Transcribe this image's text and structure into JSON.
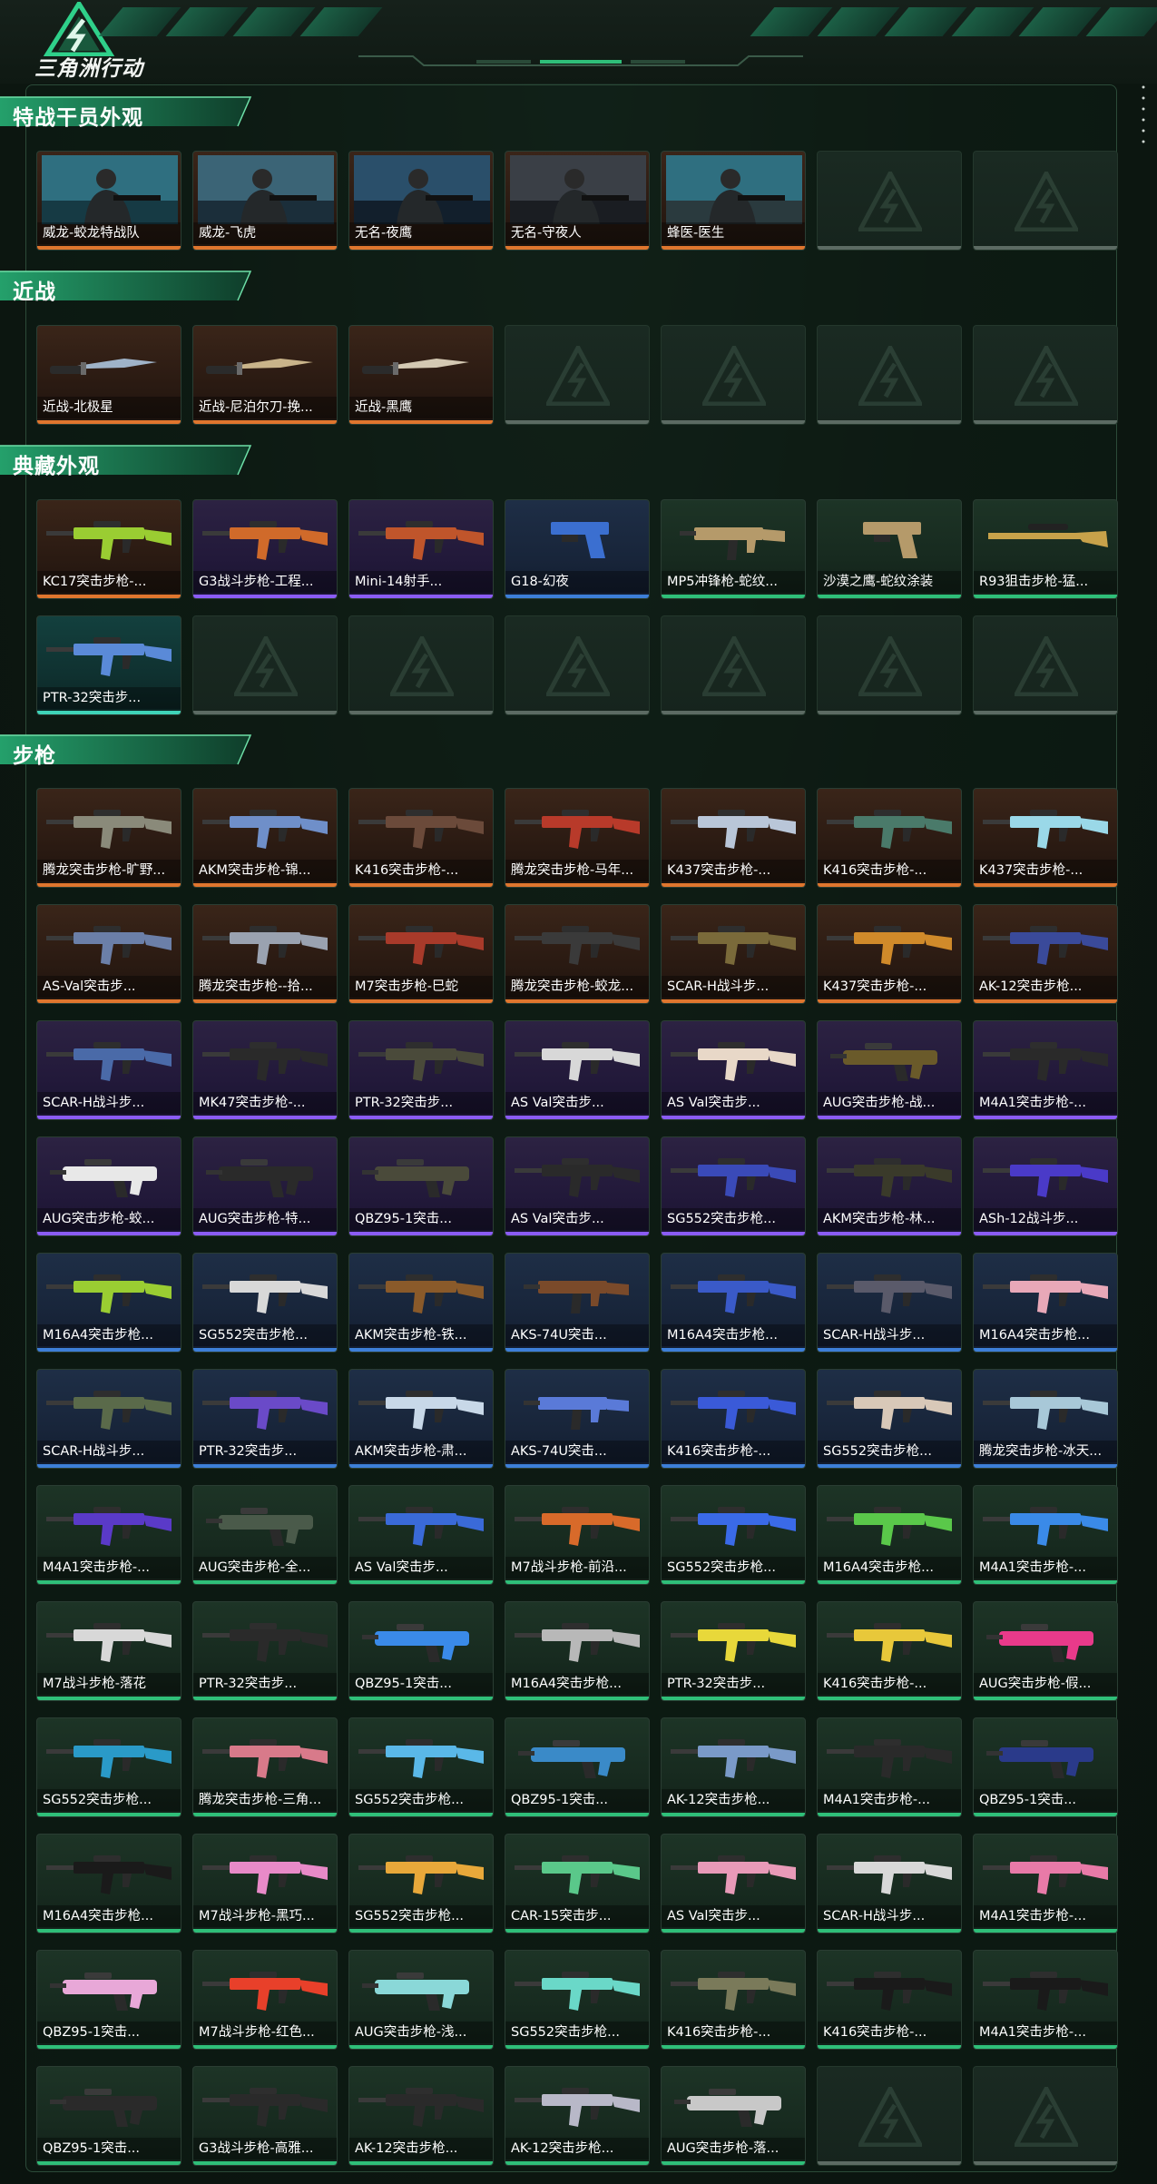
{
  "app": {
    "title": "三角洲行动",
    "logo_icon": "delta-force-emblem-icon"
  },
  "colors": {
    "accent": "#2fbf79",
    "rarity_orange": "#e0762e",
    "rarity_purple": "#8b5cf6",
    "rarity_blue": "#3d7fd8",
    "rarity_green": "#2fbf79",
    "rarity_teal": "#3fd4b8"
  },
  "sections": [
    {
      "key": "operators",
      "title": "特战干员外观",
      "items": [
        {
          "label": "威龙-蛟龙特战队",
          "rarity": "orange",
          "kind": "operator"
        },
        {
          "label": "威龙-飞虎",
          "rarity": "orange",
          "kind": "operator"
        },
        {
          "label": "无名-夜鹰",
          "rarity": "orange",
          "kind": "operator"
        },
        {
          "label": "无名-守夜人",
          "rarity": "orange",
          "kind": "operator"
        },
        {
          "label": "蜂医-医生",
          "rarity": "orange",
          "kind": "operator"
        },
        {
          "label": "",
          "rarity": "empty"
        },
        {
          "label": "",
          "rarity": "empty"
        }
      ]
    },
    {
      "key": "melee",
      "title": "近战",
      "items": [
        {
          "label": "近战-北极星",
          "rarity": "orange",
          "kind": "knife",
          "color": "#9fb3c8"
        },
        {
          "label": "近战-尼泊尔刀-挽...",
          "rarity": "orange",
          "kind": "knife",
          "color": "#c9b48a"
        },
        {
          "label": "近战-黑鹰",
          "rarity": "orange",
          "kind": "knife",
          "color": "#d4c9b3"
        },
        {
          "label": "",
          "rarity": "empty"
        },
        {
          "label": "",
          "rarity": "empty"
        },
        {
          "label": "",
          "rarity": "empty"
        },
        {
          "label": "",
          "rarity": "empty"
        }
      ]
    },
    {
      "key": "collection",
      "title": "典藏外观",
      "items": [
        {
          "label": "KC17突击步枪-...",
          "rarity": "orange",
          "kind": "rifle",
          "color": "#9acd32"
        },
        {
          "label": "G3战斗步枪-工程...",
          "rarity": "purple",
          "kind": "rifle",
          "color": "#d06a2a"
        },
        {
          "label": "Mini-14射手...",
          "rarity": "purple",
          "kind": "rifle",
          "color": "#c0552b"
        },
        {
          "label": "G18-幻夜",
          "rarity": "blue",
          "kind": "pistol",
          "color": "#3b6fd0"
        },
        {
          "label": "MP5冲锋枪-蛇纹...",
          "rarity": "green",
          "kind": "smg",
          "color": "#b59a6a"
        },
        {
          "label": "沙漠之鹰-蛇纹涂装",
          "rarity": "green",
          "kind": "pistol",
          "color": "#b59a6a"
        },
        {
          "label": "R93狙击步枪-猛...",
          "rarity": "green",
          "kind": "sniper",
          "color": "#c8a24a"
        },
        {
          "label": "PTR-32突击步...",
          "rarity": "teal",
          "kind": "rifle",
          "color": "#5a8ad8"
        },
        {
          "label": "",
          "rarity": "empty"
        },
        {
          "label": "",
          "rarity": "empty"
        },
        {
          "label": "",
          "rarity": "empty"
        },
        {
          "label": "",
          "rarity": "empty"
        },
        {
          "label": "",
          "rarity": "empty"
        },
        {
          "label": "",
          "rarity": "empty"
        }
      ]
    },
    {
      "key": "rifles",
      "title": "步枪",
      "items": [
        {
          "label": "腾龙突击步枪-旷野...",
          "rarity": "orange",
          "kind": "rifle",
          "color": "#8a8a7a"
        },
        {
          "label": "AKM突击步枪-锦...",
          "rarity": "orange",
          "kind": "rifle",
          "color": "#6f8fc9"
        },
        {
          "label": "K416突击步枪-...",
          "rarity": "orange",
          "kind": "rifle",
          "color": "#6b4a3a"
        },
        {
          "label": "腾龙突击步枪-马年...",
          "rarity": "orange",
          "kind": "rifle",
          "color": "#b83a2a"
        },
        {
          "label": "K437突击步枪-...",
          "rarity": "orange",
          "kind": "rifle",
          "color": "#b9c6d8"
        },
        {
          "label": "K416突击步枪-...",
          "rarity": "orange",
          "kind": "rifle",
          "color": "#4a7a6a"
        },
        {
          "label": "K437突击步枪-...",
          "rarity": "orange",
          "kind": "rifle",
          "color": "#9ad8e8"
        },
        {
          "label": "AS-Val突击步...",
          "rarity": "orange",
          "kind": "rifle",
          "color": "#6b7fa8"
        },
        {
          "label": "腾龙突击步枪--拾...",
          "rarity": "orange",
          "kind": "rifle",
          "color": "#9aa2b0"
        },
        {
          "label": "M7突击步枪-巳蛇",
          "rarity": "orange",
          "kind": "rifle",
          "color": "#a83a2a"
        },
        {
          "label": "腾龙突击步枪-蛟龙...",
          "rarity": "orange",
          "kind": "rifle",
          "color": "#3a3a3a"
        },
        {
          "label": "SCAR-H战斗步...",
          "rarity": "orange",
          "kind": "rifle",
          "color": "#7a6a3a"
        },
        {
          "label": "K437突击步枪-...",
          "rarity": "orange",
          "kind": "rifle",
          "color": "#d08a2a"
        },
        {
          "label": "AK-12突击步枪...",
          "rarity": "orange",
          "kind": "rifle",
          "color": "#3a4a9a"
        },
        {
          "label": "SCAR-H战斗步...",
          "rarity": "purple",
          "kind": "rifle",
          "color": "#4a6aa8"
        },
        {
          "label": "MK47突击步枪-...",
          "rarity": "purple",
          "kind": "rifle",
          "color": "#2a2a2a"
        },
        {
          "label": "PTR-32突击步...",
          "rarity": "purple",
          "kind": "rifle",
          "color": "#4a4a3a"
        },
        {
          "label": "AS Val突击步...",
          "rarity": "purple",
          "kind": "rifle",
          "color": "#d8d8d8"
        },
        {
          "label": "AS Val突击步...",
          "rarity": "purple",
          "kind": "rifle",
          "color": "#e8d8c8"
        },
        {
          "label": "AUG突击步枪-战...",
          "rarity": "purple",
          "kind": "bullpup",
          "color": "#6a5a2a"
        },
        {
          "label": "M4A1突击步枪-...",
          "rarity": "purple",
          "kind": "rifle",
          "color": "#2a2a2a"
        },
        {
          "label": "AUG突击步枪-蛟...",
          "rarity": "purple",
          "kind": "bullpup",
          "color": "#e8e8e8"
        },
        {
          "label": "AUG突击步枪-特...",
          "rarity": "purple",
          "kind": "bullpup",
          "color": "#2a2a2a"
        },
        {
          "label": "QBZ95-1突击...",
          "rarity": "purple",
          "kind": "bullpup",
          "color": "#4a4a3a"
        },
        {
          "label": "AS Val突击步...",
          "rarity": "purple",
          "kind": "rifle",
          "color": "#2a2a2a"
        },
        {
          "label": "SG552突击步枪...",
          "rarity": "purple",
          "kind": "rifle",
          "color": "#3a4ab8"
        },
        {
          "label": "AKM突击步枪-林...",
          "rarity": "purple",
          "kind": "rifle",
          "color": "#3a3a2a"
        },
        {
          "label": "ASh-12战斗步...",
          "rarity": "purple",
          "kind": "rifle",
          "color": "#4a3ac8"
        },
        {
          "label": "M16A4突击步枪...",
          "rarity": "blue",
          "kind": "rifle",
          "color": "#9acd32"
        },
        {
          "label": "SG552突击步枪...",
          "rarity": "blue",
          "kind": "rifle",
          "color": "#d8d8d8"
        },
        {
          "label": "AKM突击步枪-铁...",
          "rarity": "blue",
          "kind": "rifle",
          "color": "#8a5a2a"
        },
        {
          "label": "AKS-74U突击...",
          "rarity": "blue",
          "kind": "smg",
          "color": "#7a4a2a"
        },
        {
          "label": "M16A4突击步枪...",
          "rarity": "blue",
          "kind": "rifle",
          "color": "#3a5ac8"
        },
        {
          "label": "SCAR-H战斗步...",
          "rarity": "blue",
          "kind": "rifle",
          "color": "#5a5a6a"
        },
        {
          "label": "M16A4突击步枪...",
          "rarity": "blue",
          "kind": "rifle",
          "color": "#e8a8b8"
        },
        {
          "label": "SCAR-H战斗步...",
          "rarity": "blue",
          "kind": "rifle",
          "color": "#5a6a4a"
        },
        {
          "label": "PTR-32突击步...",
          "rarity": "blue",
          "kind": "rifle",
          "color": "#6a4ac8"
        },
        {
          "label": "AKM突击步枪-肃...",
          "rarity": "blue",
          "kind": "rifle",
          "color": "#c8d8e8"
        },
        {
          "label": "AKS-74U突击...",
          "rarity": "blue",
          "kind": "smg",
          "color": "#5a7ad8"
        },
        {
          "label": "K416突击步枪-...",
          "rarity": "blue",
          "kind": "rifle",
          "color": "#3a5ad8"
        },
        {
          "label": "SG552突击步枪...",
          "rarity": "blue",
          "kind": "rifle",
          "color": "#d8c8b8"
        },
        {
          "label": "腾龙突击步枪-冰天...",
          "rarity": "blue",
          "kind": "rifle",
          "color": "#a8c8d8"
        },
        {
          "label": "M4A1突击步枪-...",
          "rarity": "green",
          "kind": "rifle",
          "color": "#5a3ac8"
        },
        {
          "label": "AUG突击步枪-全...",
          "rarity": "green",
          "kind": "bullpup",
          "color": "#4a5a4a"
        },
        {
          "label": "AS Val突击步...",
          "rarity": "green",
          "kind": "rifle",
          "color": "#3a6ad8"
        },
        {
          "label": "M7战斗步枪-前沿...",
          "rarity": "green",
          "kind": "rifle",
          "color": "#d86a2a"
        },
        {
          "label": "SG552突击步枪...",
          "rarity": "green",
          "kind": "rifle",
          "color": "#3a6ae8"
        },
        {
          "label": "M16A4突击步枪...",
          "rarity": "green",
          "kind": "rifle",
          "color": "#5ac84a"
        },
        {
          "label": "M4A1突击步枪-...",
          "rarity": "green",
          "kind": "rifle",
          "color": "#3a8ae8"
        },
        {
          "label": "M7战斗步枪-落花",
          "rarity": "green",
          "kind": "rifle",
          "color": "#d8d8d8"
        },
        {
          "label": "PTR-32突击步...",
          "rarity": "green",
          "kind": "rifle",
          "color": "#2a2a2a"
        },
        {
          "label": "QBZ95-1突击...",
          "rarity": "green",
          "kind": "bullpup",
          "color": "#3a8ae8"
        },
        {
          "label": "M16A4突击步枪...",
          "rarity": "green",
          "kind": "rifle",
          "color": "#b8b8b8"
        },
        {
          "label": "PTR-32突击步...",
          "rarity": "green",
          "kind": "rifle",
          "color": "#e8d83a"
        },
        {
          "label": "K416突击步枪-...",
          "rarity": "green",
          "kind": "rifle",
          "color": "#e8c83a"
        },
        {
          "label": "AUG突击步枪-假...",
          "rarity": "green",
          "kind": "bullpup",
          "color": "#e83a8a"
        },
        {
          "label": "SG552突击步枪...",
          "rarity": "green",
          "kind": "rifle",
          "color": "#2a9ac8"
        },
        {
          "label": "腾龙突击步枪-三角...",
          "rarity": "green",
          "kind": "rifle",
          "color": "#d87a8a"
        },
        {
          "label": "SG552突击步枪...",
          "rarity": "green",
          "kind": "rifle",
          "color": "#5ab8e8"
        },
        {
          "label": "QBZ95-1突击...",
          "rarity": "green",
          "kind": "bullpup",
          "color": "#3a8ac8"
        },
        {
          "label": "AK-12突击步枪...",
          "rarity": "green",
          "kind": "rifle",
          "color": "#7a9ac8"
        },
        {
          "label": "M4A1突击步枪-...",
          "rarity": "green",
          "kind": "rifle",
          "color": "#2a2a2a"
        },
        {
          "label": "QBZ95-1突击...",
          "rarity": "green",
          "kind": "bullpup",
          "color": "#2a3a8a"
        },
        {
          "label": "M16A4突击步枪...",
          "rarity": "green",
          "kind": "rifle",
          "color": "#1a1a1a"
        },
        {
          "label": "M7战斗步枪-黑巧...",
          "rarity": "green",
          "kind": "rifle",
          "color": "#e88ac8"
        },
        {
          "label": "SG552突击步枪...",
          "rarity": "green",
          "kind": "rifle",
          "color": "#e8a83a"
        },
        {
          "label": "CAR-15突击步...",
          "rarity": "green",
          "kind": "rifle",
          "color": "#5ac88a"
        },
        {
          "label": "AS Val突击步...",
          "rarity": "green",
          "kind": "rifle",
          "color": "#e89ab8"
        },
        {
          "label": "SCAR-H战斗步...",
          "rarity": "green",
          "kind": "rifle",
          "color": "#d8d8d8"
        },
        {
          "label": "M4A1突击步枪-...",
          "rarity": "green",
          "kind": "rifle",
          "color": "#e87aa8"
        },
        {
          "label": "QBZ95-1突击...",
          "rarity": "green",
          "kind": "bullpup",
          "color": "#e8a8d8"
        },
        {
          "label": "M7战斗步枪-红色...",
          "rarity": "green",
          "kind": "rifle",
          "color": "#e8402a"
        },
        {
          "label": "AUG突击步枪-浅...",
          "rarity": "green",
          "kind": "bullpup",
          "color": "#8ad8d8"
        },
        {
          "label": "SG552突击步枪...",
          "rarity": "green",
          "kind": "rifle",
          "color": "#6ad8c8"
        },
        {
          "label": "K416突击步枪-...",
          "rarity": "green",
          "kind": "rifle",
          "color": "#7a7a5a"
        },
        {
          "label": "K416突击步枪-...",
          "rarity": "green",
          "kind": "rifle",
          "color": "#1a1a1a"
        },
        {
          "label": "M4A1突击步枪-...",
          "rarity": "green",
          "kind": "rifle",
          "color": "#1a1a1a"
        },
        {
          "label": "QBZ95-1突击...",
          "rarity": "green",
          "kind": "bullpup",
          "color": "#2a2a2a"
        },
        {
          "label": "G3战斗步枪-高雅...",
          "rarity": "green",
          "kind": "rifle",
          "color": "#2a2a2a"
        },
        {
          "label": "AK-12突击步枪...",
          "rarity": "green",
          "kind": "rifle",
          "color": "#2a2a2a"
        },
        {
          "label": "AK-12突击步枪...",
          "rarity": "green",
          "kind": "rifle",
          "color": "#b8b8c8"
        },
        {
          "label": "AUG突击步枪-落...",
          "rarity": "green",
          "kind": "bullpup",
          "color": "#c8c8c8"
        },
        {
          "label": "",
          "rarity": "empty"
        },
        {
          "label": "",
          "rarity": "empty"
        }
      ]
    }
  ]
}
